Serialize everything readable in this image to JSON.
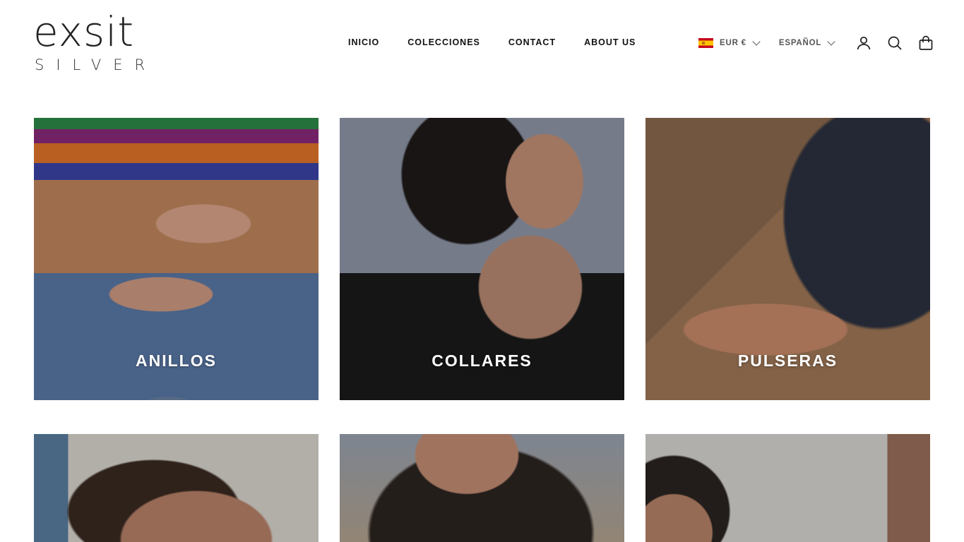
{
  "brand": {
    "logo_top": "exsit",
    "logo_bottom": "SILVER"
  },
  "nav": [
    {
      "label": "INICIO"
    },
    {
      "label": "COLECCIONES"
    },
    {
      "label": "CONTACT"
    },
    {
      "label": "ABOUT US"
    }
  ],
  "currency": {
    "selected": "EUR €",
    "flag_icon": "spain-flag-icon"
  },
  "language": {
    "selected": "ESPAÑOL"
  },
  "icons": {
    "account": "user-icon",
    "search": "search-icon",
    "cart": "shopping-bag-icon"
  },
  "collections": [
    {
      "label": "ANILLOS"
    },
    {
      "label": "COLLARES"
    },
    {
      "label": "PULSERAS"
    },
    {
      "label": ""
    },
    {
      "label": ""
    },
    {
      "label": ""
    }
  ],
  "colors": {
    "text": "#1c1c1c",
    "background": "#ffffff",
    "label_text": "#ffffff"
  }
}
